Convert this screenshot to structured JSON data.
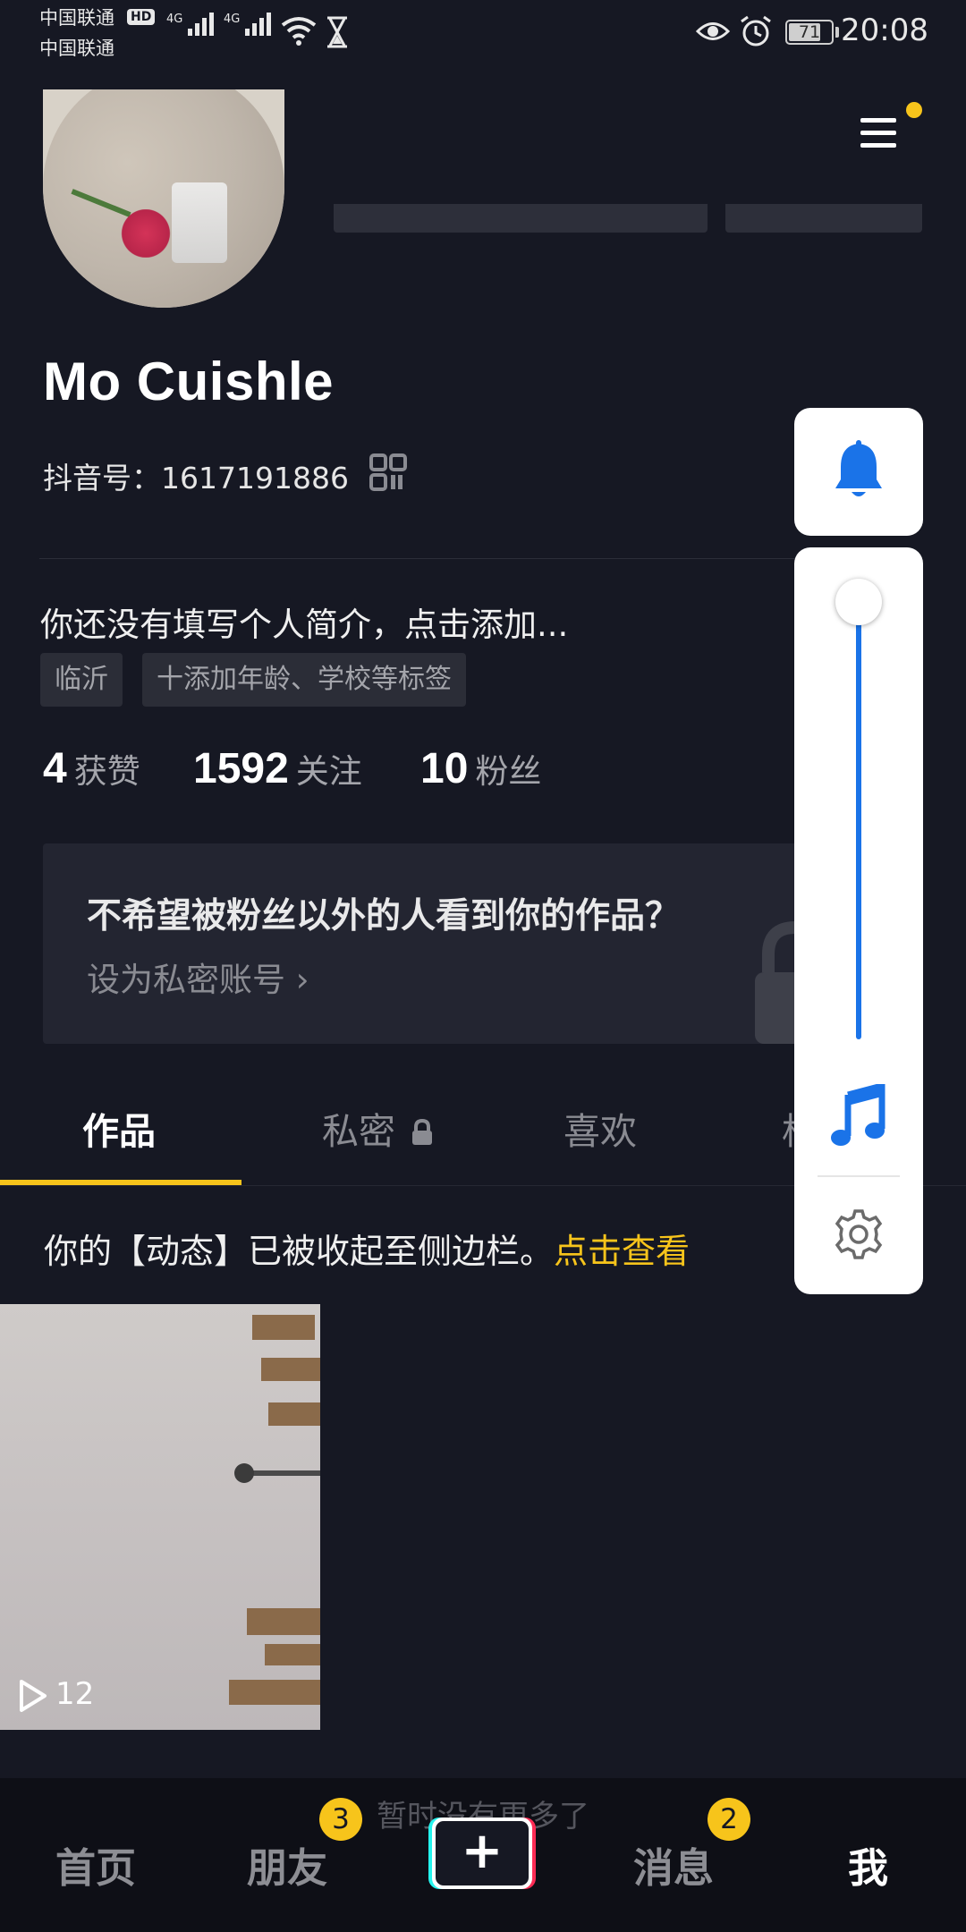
{
  "status_bar": {
    "carrier_1": "中国联通",
    "carrier_2": "中国联通",
    "hd": "HD",
    "net_1": "4G",
    "net_2": "4G",
    "battery": "71",
    "time": "20:08",
    "icons": [
      "signal-icon",
      "wifi-icon",
      "hourglass-icon",
      "eye-icon",
      "alarm-icon",
      "battery-icon"
    ]
  },
  "header": {
    "menu_icon": "menu-icon",
    "has_notification_dot": true
  },
  "profile": {
    "name": "Mo Cuishle",
    "douyin_id": "抖音号：1617191886",
    "bio": "你还没有填写个人简介，点击添加...",
    "tags": [
      "临沂",
      "十添加年龄、学校等标签"
    ],
    "stats": [
      {
        "value": "4",
        "label": "获赞"
      },
      {
        "value": "1592",
        "label": "关注"
      },
      {
        "value": "10",
        "label": "粉丝"
      }
    ]
  },
  "privacy_card": {
    "title": "不希望被粉丝以外的人看到你的作品？",
    "link": "设为私密账号"
  },
  "tabs": [
    {
      "label": "作品",
      "active": true
    },
    {
      "label": "私密",
      "locked": true
    },
    {
      "label": "喜欢"
    },
    {
      "label": "格"
    }
  ],
  "notice": {
    "text": "你的【动态】已被收起至侧边栏。",
    "link": "点击查看"
  },
  "video": {
    "play_count": "12"
  },
  "footer_hint": "暂时没有更多了",
  "bottom_nav": {
    "items": [
      "首页",
      "朋友",
      "消息",
      "我"
    ],
    "friends_badge": "3",
    "messages_badge": "2",
    "create": "+"
  },
  "floating_panel": {
    "volume_level": 1.0,
    "icons": [
      "bell-icon",
      "music-note-icon",
      "settings-icon"
    ],
    "accent": "#1a73e8"
  },
  "colors": {
    "accent_yellow": "#f7c41b",
    "background": "#161823"
  }
}
